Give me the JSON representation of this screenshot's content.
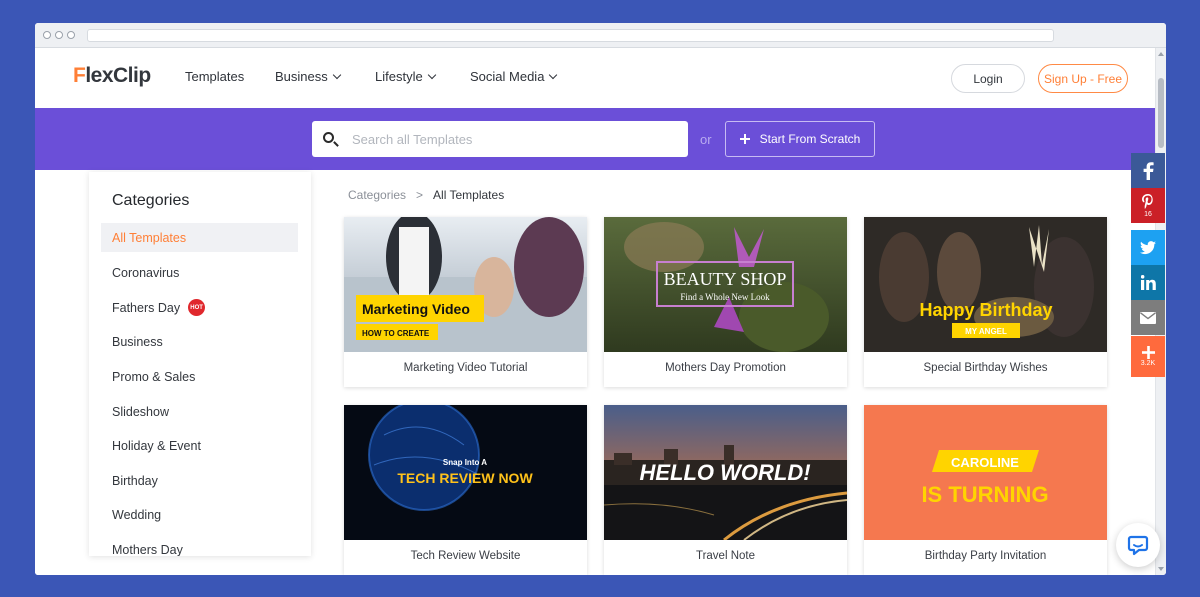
{
  "header": {
    "brand": "FlexClip",
    "nav": [
      {
        "label": "Templates",
        "has_dropdown": false
      },
      {
        "label": "Business",
        "has_dropdown": true
      },
      {
        "label": "Lifestyle",
        "has_dropdown": true
      },
      {
        "label": "Social Media",
        "has_dropdown": true
      }
    ],
    "login_label": "Login",
    "signup_label": "Sign Up - Free"
  },
  "search": {
    "placeholder": "Search all Templates",
    "or_label": "or",
    "scratch_label": "Start From Scratch"
  },
  "sidebar": {
    "title": "Categories",
    "items": [
      {
        "label": "All Templates",
        "active": true
      },
      {
        "label": "Coronavirus"
      },
      {
        "label": "Fathers Day",
        "badge": "HOT"
      },
      {
        "label": "Business"
      },
      {
        "label": "Promo & Sales"
      },
      {
        "label": "Slideshow"
      },
      {
        "label": "Holiday & Event"
      },
      {
        "label": "Birthday"
      },
      {
        "label": "Wedding"
      },
      {
        "label": "Mothers Day"
      }
    ]
  },
  "breadcrumb": {
    "root": "Categories",
    "separator": ">",
    "current": "All Templates"
  },
  "templates": [
    {
      "title": "Marketing Video Tutorial",
      "overlay_main": "Marketing Video",
      "overlay_sub": "HOW TO CREATE"
    },
    {
      "title": "Mothers Day Promotion",
      "overlay_main": "BEAUTY SHOP",
      "overlay_sub": "Find a Whole New Look"
    },
    {
      "title": "Special Birthday Wishes",
      "overlay_main": "Happy Birthday",
      "overlay_sub": "MY ANGEL"
    },
    {
      "title": "Tech Review Website",
      "overlay_main": "TECH REVIEW NOW",
      "overlay_sub": "Snap Into A"
    },
    {
      "title": "Travel Note",
      "overlay_main": "HELLO WORLD!"
    },
    {
      "title": "Birthday Party Invitation",
      "overlay_main": "IS TURNING",
      "overlay_sub": "CAROLINE"
    }
  ],
  "share": {
    "pinterest_count": "16",
    "more_count": "3.2K"
  },
  "colors": {
    "accent_orange": "#ff7f36",
    "band_purple": "#6b4fd8",
    "facebook": "#3b5998",
    "pinterest": "#cb2027",
    "twitter": "#1da1f2",
    "linkedin": "#0e76a8",
    "email": "#7d7d7d",
    "more": "#ff6a3d",
    "chat_blue": "#1f73e8"
  },
  "icons": [
    "search-icon",
    "plus-icon",
    "chevron-down-icon",
    "facebook-icon",
    "pinterest-icon",
    "twitter-icon",
    "linkedin-icon",
    "email-icon",
    "plus-share-icon",
    "chat-icon"
  ]
}
